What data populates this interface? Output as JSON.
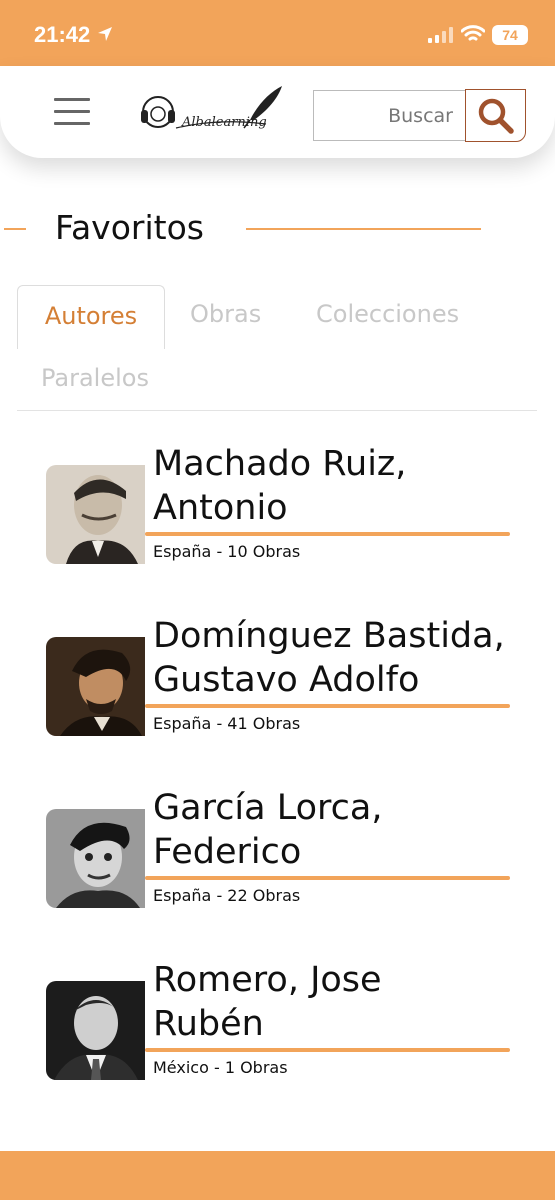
{
  "status": {
    "time": "21:42",
    "battery": "74"
  },
  "header": {
    "logo_text": "Albalearning",
    "search": {
      "placeholder": "Buscar"
    }
  },
  "favorites": {
    "title": "Favoritos",
    "tabs": [
      {
        "label": "Autores",
        "active": true
      },
      {
        "label": "Obras",
        "active": false
      },
      {
        "label": "Colecciones",
        "active": false
      },
      {
        "label": "Paralelos",
        "active": false
      }
    ]
  },
  "authors": [
    {
      "name_line1": "Machado Ruiz,",
      "name_line2": "Antonio",
      "meta": "España - 10 Obras"
    },
    {
      "name_line1": "Domínguez Bastida,",
      "name_line2": "Gustavo Adolfo",
      "meta": "España - 41 Obras"
    },
    {
      "name_line1": "García Lorca,",
      "name_line2": "Federico",
      "meta": "España - 22 Obras"
    },
    {
      "name_line1": "Romero, Jose",
      "name_line2": "Rubén",
      "meta": "México - 1 Obras"
    }
  ],
  "colors": {
    "accent": "#F2A45A",
    "tab_active": "#D47F35",
    "search_border": "#A0522D"
  }
}
